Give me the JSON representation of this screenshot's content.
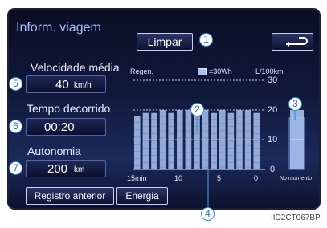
{
  "header": {
    "title": "Inform. viagem",
    "clear_label": "Limpar",
    "back_icon": "return-arrow-icon"
  },
  "stats": {
    "speed_label": "Velocidade média",
    "speed_value": "40",
    "speed_unit": "km/h",
    "time_label": "Tempo decorrido",
    "time_value": "00:20",
    "range_label": "Autonomia",
    "range_value": "200",
    "range_unit": "km"
  },
  "graph": {
    "regen_label": "Regen.",
    "legend_label": "=30Wh",
    "unit_label": "L/100km",
    "y_ticks": [
      "30",
      "20",
      "10",
      "0"
    ],
    "x_ticks": [
      "15min",
      "10",
      "5",
      "0"
    ],
    "now_label": "No momento"
  },
  "chart_data": {
    "type": "bar",
    "ylabel": "L/100km",
    "ylim": [
      0,
      30
    ],
    "xlabel": "",
    "x_tick_labels": [
      "15min",
      "10",
      "5",
      "0"
    ],
    "series": [
      {
        "values": [
          18,
          19,
          19,
          20,
          19,
          20,
          20,
          19,
          20,
          19,
          20,
          19,
          20,
          20,
          19
        ]
      }
    ],
    "current_value": 20
  },
  "footer": {
    "prev_label": "Registro anterior",
    "energy_label": "Energia"
  },
  "callouts": [
    "1",
    "2",
    "3",
    "4",
    "5",
    "6",
    "7"
  ],
  "caption": "IID2CT067BP",
  "colors": {
    "accent": "#3a8fd6",
    "bar": "#a9c2f0",
    "background": "#121a3c"
  }
}
